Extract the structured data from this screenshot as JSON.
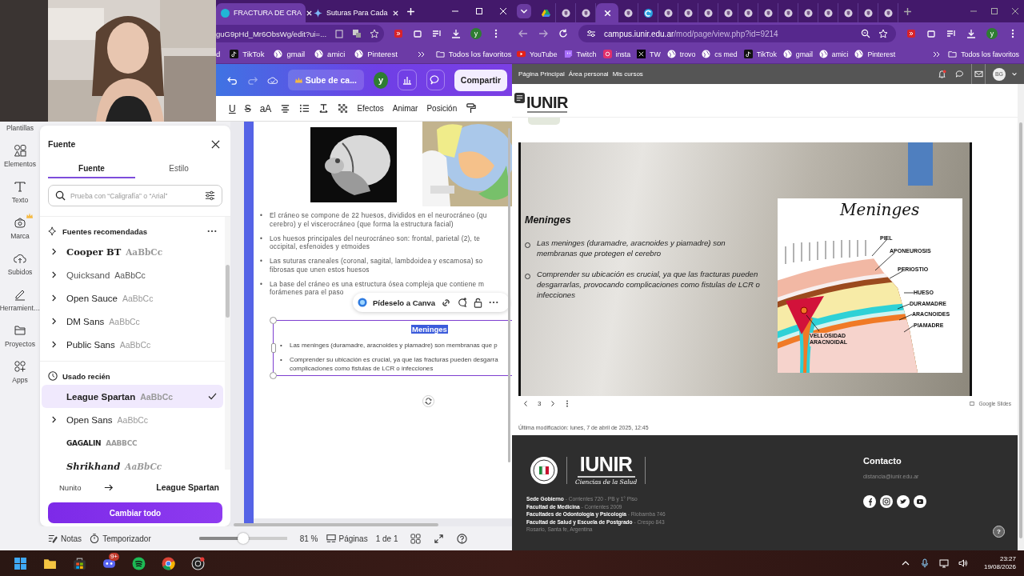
{
  "left_browser": {
    "tabs": [
      {
        "title": "FRACTURA DE CRA",
        "kind": "canva",
        "selected": true
      },
      {
        "title": "Suturas Para Cada",
        "kind": "gemini",
        "selected": false
      }
    ],
    "address": "guG9pHd_Mr6ObsWg/edit?ui=...",
    "profile": "y",
    "bookmarks": [
      {
        "label": "d",
        "kind": "none"
      },
      {
        "label": "TikTok",
        "kind": "tiktok"
      },
      {
        "label": "gmail",
        "kind": "globe"
      },
      {
        "label": "amici",
        "kind": "globe"
      },
      {
        "label": "Pinterest",
        "kind": "globe"
      }
    ],
    "all_bookmarks": "Todos los favoritos"
  },
  "canva": {
    "upgrade": "Sube de ca...",
    "avatar": "y",
    "share": "Compartir",
    "format_buttons": [
      "U",
      "S",
      "aA"
    ],
    "toolbar": [
      "Efectos",
      "Animar",
      "Posición"
    ],
    "rail": [
      {
        "label": "Plantillas",
        "kind": "none",
        "premium": false
      },
      {
        "label": "Elementos",
        "kind": "shapes",
        "premium": false
      },
      {
        "label": "Texto",
        "kind": "text",
        "premium": false
      },
      {
        "label": "Marca",
        "kind": "brand",
        "premium": true
      },
      {
        "label": "Subidos",
        "kind": "upload",
        "premium": false
      },
      {
        "label": "Herramient…",
        "kind": "pen",
        "premium": false
      },
      {
        "label": "Proyectos",
        "kind": "folder",
        "premium": false
      },
      {
        "label": "Apps",
        "kind": "apps",
        "premium": false
      }
    ],
    "font_panel": {
      "title": "Fuente",
      "tabs": [
        {
          "label": "Fuente",
          "selected": true
        },
        {
          "label": "Estilo",
          "selected": false
        }
      ],
      "placeholder": "Prueba con “Caligrafía” o “Arial”",
      "sections": [
        {
          "title": "Fuentes recomendadas",
          "kind": "sparkle",
          "fonts": [
            {
              "name": "Cooper BT",
              "sample": "AaBbCc",
              "expandable": true,
              "selected": false
            },
            {
              "name": "Quicksand",
              "sample": "AaBbCc",
              "expandable": true,
              "selected": false
            },
            {
              "name": "Open Sauce",
              "sample": "AaBbCc",
              "expandable": true,
              "selected": false
            },
            {
              "name": "DM Sans",
              "sample": "AaBbCc",
              "expandable": true,
              "selected": false
            },
            {
              "name": "Public Sans",
              "sample": "AaBbCc",
              "expandable": true,
              "selected": false
            }
          ]
        },
        {
          "title": "Usado recién",
          "kind": "clock",
          "fonts": [
            {
              "name": "League Spartan",
              "sample": "AaBbCc",
              "expandable": false,
              "selected": true
            },
            {
              "name": "Open Sans",
              "sample": "AaBbCc",
              "expandable": true,
              "selected": false
            },
            {
              "name": "GAGALIN",
              "sample": "AABBCC",
              "expandable": false,
              "selected": false
            },
            {
              "name": "Shrikhand",
              "sample": "AaBbCc",
              "expandable": false,
              "selected": false
            }
          ]
        }
      ],
      "replace_from": "Nunito",
      "replace_to": "League Spartan",
      "apply": "Cambiar todo"
    },
    "page": {
      "marker": "•",
      "bullets": [
        "El cráneo se compone de 22 huesos, divididos en el neurocráneo (qu\ncerebro) y el viscerocráneo (que forma la estructura facial)",
        "Los huesos principales del neurocráneo son: frontal, parietal (2), te\noccipital, esfenoides y etmoides",
        "Las suturas craneales (coronal, sagital, lambdoidea y escamosa) so\nfibrosas que unen estos huesos",
        "La base del cráneo es una estructura ósea compleja que contiene m\nforámenes para el paso"
      ],
      "ai_bar": "Pídeselo a Canva",
      "textbox": {
        "heading": "Meninges",
        "heading_selected": true,
        "bullets": [
          "Las meninges (duramadre, aracnoides y piamadre) son membranas que p",
          "Comprender su ubicación es crucial, ya que las fracturas pueden desgarra\ncomplicaciones como fistulas de LCR o infecciones"
        ]
      }
    },
    "footer": {
      "notes": "Notas",
      "timer": "Temporizador",
      "zoom": {
        "level": 0.5,
        "reading": "81 %"
      },
      "pages": "Páginas",
      "page_count": "1 de 1"
    }
  },
  "right_browser": {
    "tabs": [
      {
        "kind": "drive",
        "selected": false
      },
      {
        "kind": "site",
        "selected": false
      },
      {
        "kind": "site",
        "selected": false
      },
      {
        "kind": "blank",
        "selected": true
      },
      {
        "kind": "site",
        "selected": false
      },
      {
        "kind": "edge",
        "selected": false
      },
      {
        "kind": "site",
        "selected": false
      },
      {
        "kind": "site",
        "selected": false
      },
      {
        "kind": "site",
        "selected": false
      },
      {
        "kind": "site",
        "selected": false
      },
      {
        "kind": "site",
        "selected": false
      },
      {
        "kind": "site",
        "selected": false
      },
      {
        "kind": "site",
        "selected": false
      },
      {
        "kind": "site",
        "selected": false
      },
      {
        "kind": "site",
        "selected": false
      },
      {
        "kind": "site",
        "selected": false
      },
      {
        "kind": "site",
        "selected": false
      },
      {
        "kind": "site",
        "selected": false
      }
    ],
    "host": "campus.iunir.edu.ar",
    "path": "/mod/page/view.php?id=9214",
    "profile": "y",
    "bookmarks": [
      {
        "label": "YouTube",
        "kind": "youtube"
      },
      {
        "label": "Twitch",
        "kind": "twitch"
      },
      {
        "label": "insta",
        "kind": "insta"
      },
      {
        "label": "TW",
        "kind": "x"
      },
      {
        "label": "trovo",
        "kind": "globe"
      },
      {
        "label": "cs med",
        "kind": "globe"
      },
      {
        "label": "TikTok",
        "kind": "tiktok"
      },
      {
        "label": "gmail",
        "kind": "globe"
      },
      {
        "label": "amici",
        "kind": "globe"
      },
      {
        "label": "Pinterest",
        "kind": "globe"
      }
    ],
    "all_bookmarks": "Todos los favoritos"
  },
  "moodle": {
    "nav": [
      "Página Principal",
      "Área personal",
      "Mis cursos"
    ],
    "avatar": "BG",
    "logo": "IUNIR",
    "slide": {
      "title": "Meninges",
      "bullets": [
        "Las meninges (duramadre, aracnoides y piamadre) son\nmembranas que protegen el cerebro",
        "Comprender su ubicación es crucial, ya que las fracturas pueden\ndesgarrarlas, provocando complicaciones como fistulas de LCR o\ninfecciones"
      ],
      "diagram": {
        "title": "Meninges",
        "labels": [
          "PIEL",
          "APONEUROSIS",
          "PERIOSTIO",
          "HUESO",
          "DURAMADRE",
          "ARACNOIDES",
          "PIAMADRE",
          "VELLOSIDAD ARACNOIDAL"
        ]
      },
      "page": "3",
      "provider": "Google Slides"
    },
    "modified": "Última modificación: lunes, 7 de abril de 2025, 12:45",
    "footer": {
      "logo": "IUNIR",
      "tagline": "Ciencias de la Salud",
      "addresses": [
        "**Sede Gobierno** - Corrientes 720 - PB y 1° Piso",
        "**Facultad de Medicina** - Corrientes 2009",
        "**Facultades de Odontología y Psicología** - Riobamba 746",
        "**Facultad de Salud y Escuela de Postgrado** - Crespo 843",
        "Rosario, Santa fe, Argentina"
      ],
      "contact_title": "Contacto",
      "email": "distancia@iunir.edu.ar",
      "help": "?"
    }
  },
  "taskbar": {
    "apps": [
      {
        "kind": "windows"
      },
      {
        "kind": "folder"
      },
      {
        "kind": "store"
      },
      {
        "kind": "discord",
        "badge": "9+"
      },
      {
        "kind": "spotify"
      },
      {
        "kind": "chrome"
      },
      {
        "kind": "obs"
      }
    ],
    "time": "23:27",
    "date": "19/08/2026"
  }
}
